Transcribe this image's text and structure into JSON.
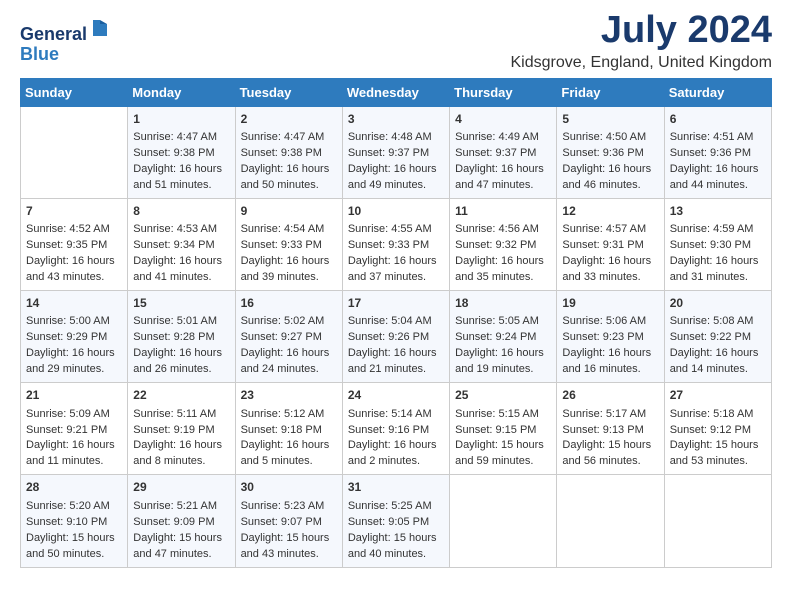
{
  "header": {
    "logo_general": "General",
    "logo_blue": "Blue",
    "month_title": "July 2024",
    "location": "Kidsgrove, England, United Kingdom"
  },
  "days_of_week": [
    "Sunday",
    "Monday",
    "Tuesday",
    "Wednesday",
    "Thursday",
    "Friday",
    "Saturday"
  ],
  "weeks": [
    [
      {
        "day": "",
        "content": ""
      },
      {
        "day": "1",
        "content": "Sunrise: 4:47 AM\nSunset: 9:38 PM\nDaylight: 16 hours\nand 51 minutes."
      },
      {
        "day": "2",
        "content": "Sunrise: 4:47 AM\nSunset: 9:38 PM\nDaylight: 16 hours\nand 50 minutes."
      },
      {
        "day": "3",
        "content": "Sunrise: 4:48 AM\nSunset: 9:37 PM\nDaylight: 16 hours\nand 49 minutes."
      },
      {
        "day": "4",
        "content": "Sunrise: 4:49 AM\nSunset: 9:37 PM\nDaylight: 16 hours\nand 47 minutes."
      },
      {
        "day": "5",
        "content": "Sunrise: 4:50 AM\nSunset: 9:36 PM\nDaylight: 16 hours\nand 46 minutes."
      },
      {
        "day": "6",
        "content": "Sunrise: 4:51 AM\nSunset: 9:36 PM\nDaylight: 16 hours\nand 44 minutes."
      }
    ],
    [
      {
        "day": "7",
        "content": "Sunrise: 4:52 AM\nSunset: 9:35 PM\nDaylight: 16 hours\nand 43 minutes."
      },
      {
        "day": "8",
        "content": "Sunrise: 4:53 AM\nSunset: 9:34 PM\nDaylight: 16 hours\nand 41 minutes."
      },
      {
        "day": "9",
        "content": "Sunrise: 4:54 AM\nSunset: 9:33 PM\nDaylight: 16 hours\nand 39 minutes."
      },
      {
        "day": "10",
        "content": "Sunrise: 4:55 AM\nSunset: 9:33 PM\nDaylight: 16 hours\nand 37 minutes."
      },
      {
        "day": "11",
        "content": "Sunrise: 4:56 AM\nSunset: 9:32 PM\nDaylight: 16 hours\nand 35 minutes."
      },
      {
        "day": "12",
        "content": "Sunrise: 4:57 AM\nSunset: 9:31 PM\nDaylight: 16 hours\nand 33 minutes."
      },
      {
        "day": "13",
        "content": "Sunrise: 4:59 AM\nSunset: 9:30 PM\nDaylight: 16 hours\nand 31 minutes."
      }
    ],
    [
      {
        "day": "14",
        "content": "Sunrise: 5:00 AM\nSunset: 9:29 PM\nDaylight: 16 hours\nand 29 minutes."
      },
      {
        "day": "15",
        "content": "Sunrise: 5:01 AM\nSunset: 9:28 PM\nDaylight: 16 hours\nand 26 minutes."
      },
      {
        "day": "16",
        "content": "Sunrise: 5:02 AM\nSunset: 9:27 PM\nDaylight: 16 hours\nand 24 minutes."
      },
      {
        "day": "17",
        "content": "Sunrise: 5:04 AM\nSunset: 9:26 PM\nDaylight: 16 hours\nand 21 minutes."
      },
      {
        "day": "18",
        "content": "Sunrise: 5:05 AM\nSunset: 9:24 PM\nDaylight: 16 hours\nand 19 minutes."
      },
      {
        "day": "19",
        "content": "Sunrise: 5:06 AM\nSunset: 9:23 PM\nDaylight: 16 hours\nand 16 minutes."
      },
      {
        "day": "20",
        "content": "Sunrise: 5:08 AM\nSunset: 9:22 PM\nDaylight: 16 hours\nand 14 minutes."
      }
    ],
    [
      {
        "day": "21",
        "content": "Sunrise: 5:09 AM\nSunset: 9:21 PM\nDaylight: 16 hours\nand 11 minutes."
      },
      {
        "day": "22",
        "content": "Sunrise: 5:11 AM\nSunset: 9:19 PM\nDaylight: 16 hours\nand 8 minutes."
      },
      {
        "day": "23",
        "content": "Sunrise: 5:12 AM\nSunset: 9:18 PM\nDaylight: 16 hours\nand 5 minutes."
      },
      {
        "day": "24",
        "content": "Sunrise: 5:14 AM\nSunset: 9:16 PM\nDaylight: 16 hours\nand 2 minutes."
      },
      {
        "day": "25",
        "content": "Sunrise: 5:15 AM\nSunset: 9:15 PM\nDaylight: 15 hours\nand 59 minutes."
      },
      {
        "day": "26",
        "content": "Sunrise: 5:17 AM\nSunset: 9:13 PM\nDaylight: 15 hours\nand 56 minutes."
      },
      {
        "day": "27",
        "content": "Sunrise: 5:18 AM\nSunset: 9:12 PM\nDaylight: 15 hours\nand 53 minutes."
      }
    ],
    [
      {
        "day": "28",
        "content": "Sunrise: 5:20 AM\nSunset: 9:10 PM\nDaylight: 15 hours\nand 50 minutes."
      },
      {
        "day": "29",
        "content": "Sunrise: 5:21 AM\nSunset: 9:09 PM\nDaylight: 15 hours\nand 47 minutes."
      },
      {
        "day": "30",
        "content": "Sunrise: 5:23 AM\nSunset: 9:07 PM\nDaylight: 15 hours\nand 43 minutes."
      },
      {
        "day": "31",
        "content": "Sunrise: 5:25 AM\nSunset: 9:05 PM\nDaylight: 15 hours\nand 40 minutes."
      },
      {
        "day": "",
        "content": ""
      },
      {
        "day": "",
        "content": ""
      },
      {
        "day": "",
        "content": ""
      }
    ]
  ]
}
